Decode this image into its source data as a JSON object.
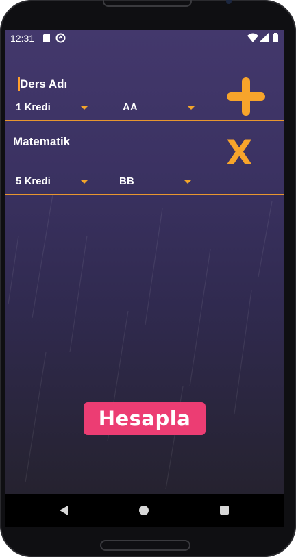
{
  "status_bar": {
    "time": "12:31",
    "icons": [
      "sd-card-icon",
      "sync-icon",
      "wifi-icon",
      "signal-icon",
      "battery-icon"
    ]
  },
  "courses": [
    {
      "name_placeholder": "Ders Adı",
      "name_value": "",
      "credit": "1 Kredi",
      "grade": "AA",
      "action_icon": "plus-icon"
    },
    {
      "name_value": "Matematik",
      "credit": "5 Kredi",
      "grade": "BB",
      "action_icon": "x-icon",
      "action_label": "X"
    }
  ],
  "calculate_button": {
    "label": "Hesapla"
  },
  "navigation": {
    "icons": [
      "back-icon",
      "home-icon",
      "recents-icon"
    ]
  },
  "colors": {
    "accent": "#f7a42b",
    "divider": "#e8962f",
    "button": "#ec3d73",
    "background_top": "#43386c",
    "background_bottom": "#25222f"
  }
}
